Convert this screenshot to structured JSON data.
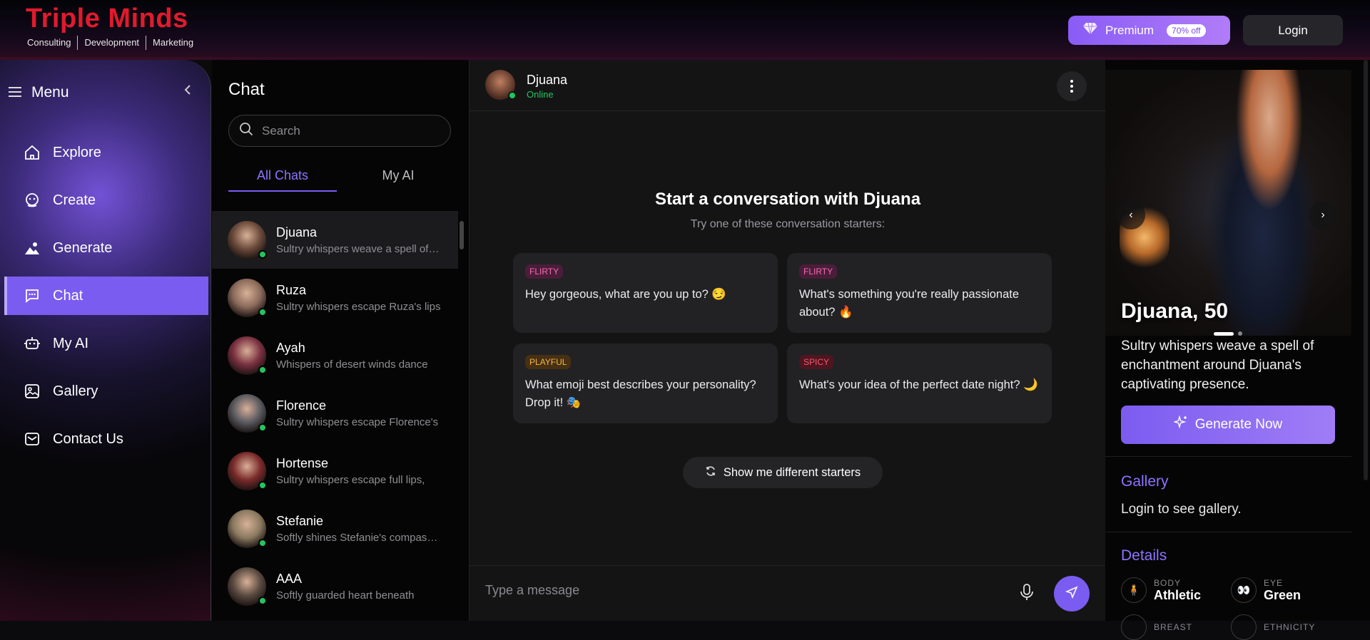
{
  "header": {
    "logo_title": "Triple Minds",
    "logo_subtitles": [
      "Consulting",
      "Development",
      "Marketing"
    ],
    "premium_label": "Premium",
    "premium_badge": "70% off",
    "login_label": "Login"
  },
  "sidebar": {
    "menu_label": "Menu",
    "items": [
      {
        "label": "Explore",
        "icon": "home-icon"
      },
      {
        "label": "Create",
        "icon": "create-icon"
      },
      {
        "label": "Generate",
        "icon": "image-icon"
      },
      {
        "label": "Chat",
        "icon": "chat-icon",
        "active": true
      },
      {
        "label": "My AI",
        "icon": "robot-icon"
      },
      {
        "label": "Gallery",
        "icon": "gallery-icon"
      },
      {
        "label": "Contact Us",
        "icon": "mail-icon"
      }
    ]
  },
  "chatlist": {
    "title": "Chat",
    "search_placeholder": "Search",
    "tabs": [
      "All Chats",
      "My AI"
    ],
    "items": [
      {
        "name": "Djuana",
        "preview": "Sultry whispers weave a spell of enchantment",
        "color": "#6b4a3a"
      },
      {
        "name": "Ruza",
        "preview": "Sultry whispers escape Ruza's lips",
        "color": "#8a6a5a"
      },
      {
        "name": "Ayah",
        "preview": "Whispers of desert winds dance",
        "color": "#7a3040"
      },
      {
        "name": "Florence",
        "preview": "Sultry whispers escape Florence's",
        "color": "#5a5a60"
      },
      {
        "name": "Hortense",
        "preview": "Sultry whispers escape full lips,",
        "color": "#7a2a2a"
      },
      {
        "name": "Stefanie",
        "preview": "Softly shines Stefanie's compassion",
        "color": "#8a7a60"
      },
      {
        "name": "AAA",
        "preview": "Softly guarded heart beneath",
        "color": "#5a4a40"
      }
    ]
  },
  "conversation": {
    "name": "Djuana",
    "status": "Online",
    "start_title": "Start a conversation with Djuana",
    "start_subtitle": "Try one of these conversation starters:",
    "starters": [
      {
        "tag": "FLIRTY",
        "kind": "flirty",
        "text": "Hey gorgeous, what are you up to? 😏"
      },
      {
        "tag": "FLIRTY",
        "kind": "flirty",
        "text": "What's something you're really passionate about? 🔥"
      },
      {
        "tag": "PLAYFUL",
        "kind": "playful",
        "text": "What emoji best describes your personality? Drop it! 🎭"
      },
      {
        "tag": "SPICY",
        "kind": "spicy",
        "text": "What's your idea of the perfect date night? 🌙"
      }
    ],
    "different_starters_label": "Show me different starters",
    "composer_placeholder": "Type a message"
  },
  "profile": {
    "name_age": "Djuana, 50",
    "bio": "Sultry whispers weave a spell of enchantment around Djuana's captivating presence.",
    "generate_label": "Generate Now",
    "gallery_title": "Gallery",
    "gallery_note": "Login to see gallery.",
    "details_title": "Details",
    "details": [
      {
        "label": "BODY",
        "value": "Athletic",
        "icon": "body-icon"
      },
      {
        "label": "EYE",
        "value": "Green",
        "icon": "eye-icon"
      },
      {
        "label": "BREAST",
        "value": "",
        "icon": "breast-icon"
      },
      {
        "label": "ETHNICITY",
        "value": "",
        "icon": "ethnicity-icon"
      }
    ]
  },
  "colors": {
    "accent": "#7b5cf0",
    "online": "#22c55e",
    "logo_red": "#e11a2d"
  }
}
